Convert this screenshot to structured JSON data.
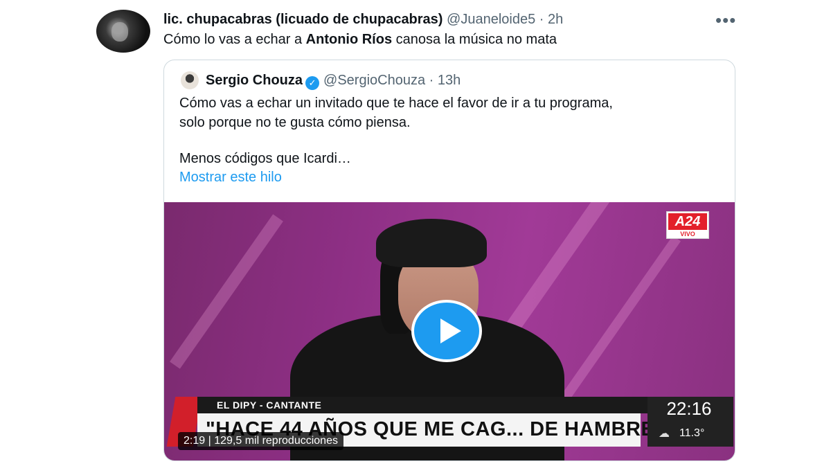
{
  "tweet": {
    "author_name": "lic. chupacabras (licuado de chupacabras)",
    "handle": "@Juaneloide5",
    "separator": "·",
    "time": "2h",
    "more": "•••",
    "text_before": "Cómo lo vas a echar a ",
    "text_bold": "Antonio Ríos",
    "text_after": " canosa la música no mata"
  },
  "quote": {
    "author_name": "Sergio Chouza",
    "verified_glyph": "✓",
    "handle": "@SergioChouza",
    "separator": "·",
    "time": "13h",
    "line1": "Cómo vas a echar un invitado que te hace el favor de ir a tu programa,",
    "line2": "solo porque no te gusta cómo piensa.",
    "line3": "Menos códigos que Icardi…",
    "show_thread": "Mostrar este hilo"
  },
  "video": {
    "channel_logo": "A24",
    "channel_live": "VIVO",
    "lower_third_name": "EL DIPY - CANTANTE",
    "lower_third_headline": "\"HACE 44 AÑOS QUE ME CAG... DE HAMBRE\"",
    "clock": "22:16",
    "temperature": "11.3°",
    "weather_glyph": "☁",
    "duration": "2:19",
    "stats_separator": "|",
    "views": "129,5 mil reproducciones"
  },
  "colors": {
    "accent": "#1d9bf0",
    "text": "#0f1419",
    "muted": "#536471",
    "border": "#cfd9de",
    "channel_red": "#e3202b"
  }
}
